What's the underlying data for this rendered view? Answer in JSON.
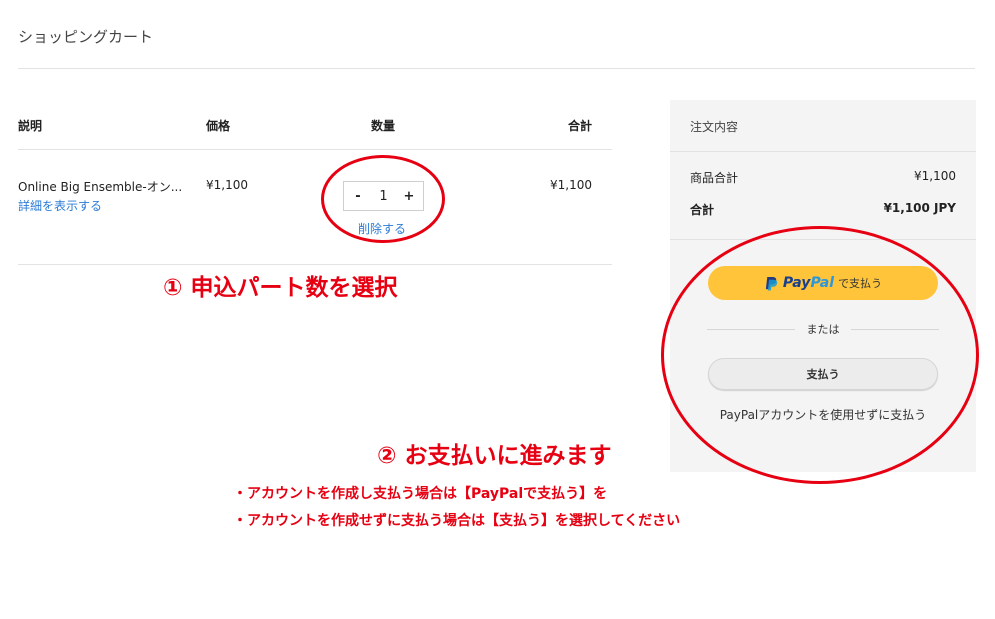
{
  "page": {
    "title": "ショッピングカート"
  },
  "cart": {
    "headers": {
      "description": "説明",
      "price": "価格",
      "quantity": "数量",
      "total": "合計"
    },
    "items": [
      {
        "name": "Online Big Ensemble-オン...",
        "details_link": "詳細を表示する",
        "price": "¥1,100",
        "quantity": "1",
        "decrement": "-",
        "increment": "+",
        "remove_link": "削除する",
        "total": "¥1,100"
      }
    ]
  },
  "summary": {
    "title": "注文内容",
    "subtotal_label": "商品合計",
    "subtotal_value": "¥1,100",
    "total_label": "合計",
    "total_value": "¥1,100 JPY",
    "paypal_button": {
      "brand_pay": "Pay",
      "brand_pal": "Pal",
      "suffix": "で支払う"
    },
    "or_text": "または",
    "pay_button": "支払う",
    "no_account_text": "PayPalアカウントを使用せずに支払う"
  },
  "annotations": {
    "step1": "① 申込パート数を選択",
    "step2": "② お支払いに進みます",
    "note1": "・アカウントを作成し支払う場合は【PayPalで支払う】を",
    "note2": "・アカウントを作成せずに支払う場合は【支払う】を選択してください",
    "accent_color": "#e60012"
  },
  "colors": {
    "link": "#2b7bd6",
    "paypal_button": "#ffc439",
    "panel_bg": "#f4f4f4"
  }
}
